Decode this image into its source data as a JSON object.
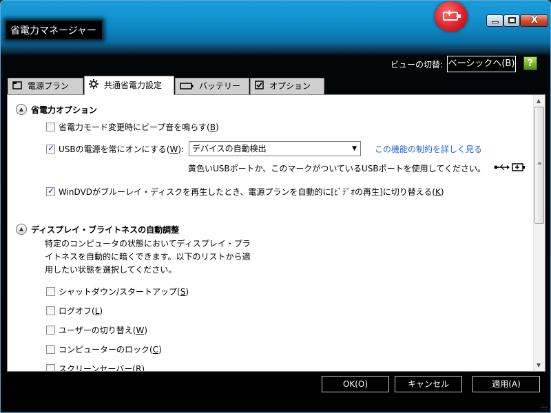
{
  "window": {
    "title": "省電力マネージャー"
  },
  "header": {
    "view_label": "ビューの切替:",
    "view_button": "ベーシックへ(B)",
    "help_icon": "?"
  },
  "tabs": [
    {
      "label": "電源プラン",
      "icon": "power-plan-icon"
    },
    {
      "label": "共通省電力設定",
      "icon": "gear-icon"
    },
    {
      "label": "バッテリー",
      "icon": "battery-icon"
    },
    {
      "label": "オプション",
      "icon": "checkbox-icon"
    }
  ],
  "section1": {
    "title": "省電力オプション",
    "beep": {
      "text": "省電力モード変更時にビープ音を鳴らす(",
      "key": "B",
      "end": ")",
      "checked": false
    },
    "usb": {
      "text": "USBの電源を常にオンにする(",
      "key": "W",
      "end": "):",
      "checked": true,
      "dropdown_value": "デバイスの自動検出",
      "link": "この機能の制約を詳しく見る",
      "note": "黄色いUSBポートか、このマークがついているUSBポートを使用してください。"
    },
    "windvd": {
      "text": "WinDVDがブルーレイ・ディスクを再生したとき、電源プランを自動的に[ﾋﾞﾃﾞｵの再生]に切り替える(",
      "key": "K",
      "end": ")",
      "checked": true
    }
  },
  "section2": {
    "title": "ディスプレイ・ブライトネスの自動調整",
    "desc_lines": [
      "特定のコンピュータの状態においてディスプレイ・プラ",
      "イトネスを自動的に暗くできます。以下のリストから適",
      "用したい状態を選択してください。"
    ],
    "items": [
      {
        "text": "シャットダウン/スタートアップ(",
        "key": "S",
        "end": ")"
      },
      {
        "text": "ログオフ(",
        "key": "L",
        "end": ")"
      },
      {
        "text": "ユーザーの切り替え(",
        "key": "W",
        "end": ")"
      },
      {
        "text": "コンピューターのロック(",
        "key": "C",
        "end": ")"
      },
      {
        "text": "スクリーンセーバー(",
        "key": "R",
        "end": ")"
      }
    ]
  },
  "footer": {
    "ok": "OK(O)",
    "cancel": "キャンセル",
    "apply": "適用(A)"
  },
  "colors": {
    "titlebar": "#1596d2",
    "link": "#1e66c8",
    "logo": "#e0202a"
  }
}
